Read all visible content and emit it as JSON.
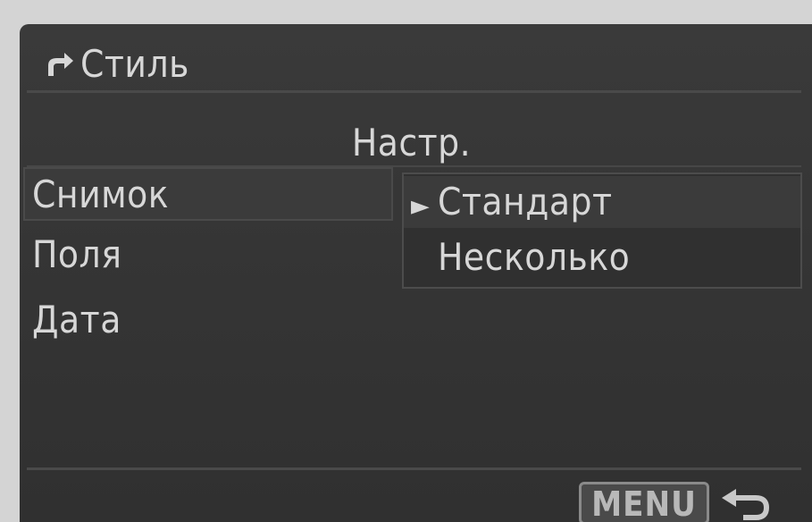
{
  "title": {
    "text": "Стиль",
    "icon": "back-arrow-icon"
  },
  "header": {
    "text": "Настр."
  },
  "left_menu": {
    "items": [
      {
        "label": "Снимок",
        "selected": true
      },
      {
        "label": "Поля",
        "selected": false
      },
      {
        "label": "Дата",
        "selected": false
      }
    ]
  },
  "submenu": {
    "items": [
      {
        "label": "Стандарт",
        "active": true,
        "marker": "►"
      },
      {
        "label": "Несколько",
        "active": false,
        "marker": ""
      }
    ]
  },
  "footer": {
    "menu_label": "MENU",
    "return_icon": "return-arrow-icon"
  },
  "colors": {
    "background": "#353535",
    "text": "#d7d7d7",
    "highlight": "#3b3b3b"
  }
}
